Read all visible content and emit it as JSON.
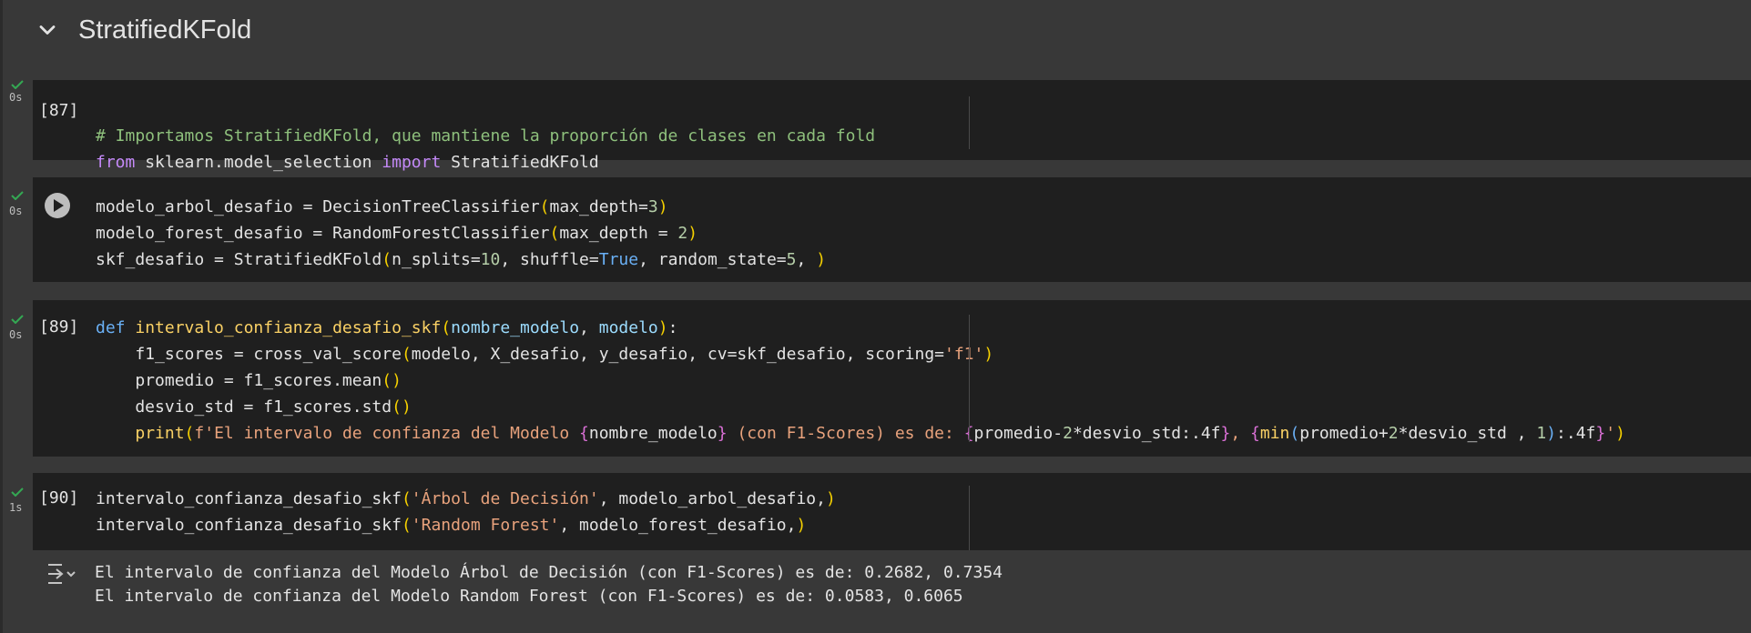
{
  "section": {
    "title": "StratifiedKFold"
  },
  "cells": [
    {
      "exec_count": "[87]",
      "exec_time": "0s",
      "status": "success",
      "code_lines": [
        "# Importamos StratifiedKFold, que mantiene la proporción de clases en cada fold",
        "from sklearn.model_selection import StratifiedKFold"
      ]
    },
    {
      "exec_count": "",
      "exec_time": "0s",
      "status": "success",
      "code_lines": [
        "modelo_arbol_desafio = DecisionTreeClassifier(max_depth=3)",
        "modelo_forest_desafio = RandomForestClassifier(max_depth = 2)",
        "skf_desafio = StratifiedKFold(n_splits=10, shuffle=True, random_state=5, )"
      ]
    },
    {
      "exec_count": "[89]",
      "exec_time": "0s",
      "status": "success",
      "code_lines": [
        "def intervalo_confianza_desafio_skf(nombre_modelo, modelo):",
        "    f1_scores = cross_val_score(modelo, X_desafio, y_desafio, cv=skf_desafio, scoring='f1')",
        "    promedio = f1_scores.mean()",
        "    desvio_std = f1_scores.std()",
        "    print(f'El intervalo de confianza del Modelo {nombre_modelo} (con F1-Scores) es de: {promedio-2*desvio_std:.4f}, {min(promedio+2*desvio_std , 1):.4f}')"
      ]
    },
    {
      "exec_count": "[90]",
      "exec_time": "1s",
      "status": "success",
      "code_lines": [
        "intervalo_confianza_desafio_skf('Árbol de Decisión', modelo_arbol_desafio,)",
        "intervalo_confianza_desafio_skf('Random Forest', modelo_forest_desafio,)"
      ]
    }
  ],
  "output": {
    "icon": "output-actions-icon",
    "lines": [
      "El intervalo de confianza del Modelo Árbol de Decisión (con F1-Scores) es de: 0.2682, 0.7354",
      "El intervalo de confianza del Modelo Random Forest (con F1-Scores) es de: 0.0583, 0.6065"
    ]
  },
  "colors": {
    "background": "#383838",
    "cell_bg": "#1f1f1f",
    "success": "#34a853"
  }
}
